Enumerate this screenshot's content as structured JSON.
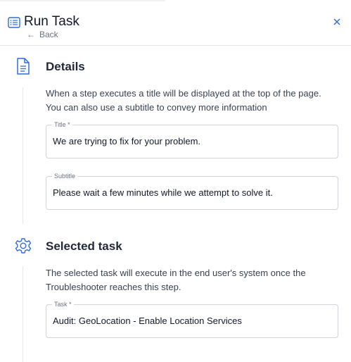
{
  "header": {
    "title": "Run Task",
    "back_label": "Back",
    "icons": {
      "title": "list-icon",
      "back": "arrow-left-icon",
      "close": "close-icon"
    }
  },
  "details": {
    "title": "Details",
    "icon": "document-icon",
    "description_line1": "When a step executes a title will be displayed at the top of the page.",
    "description_line2": "You can also use a subtitle to convey more information",
    "title_field": {
      "label": "Title *",
      "value": "We are trying to fix for your problem."
    },
    "subtitle_field": {
      "label": "Subtitle",
      "value": "Please wait a few minutes while we attempt to solve it."
    }
  },
  "selected_task": {
    "title": "Selected task",
    "icon": "gear-icon",
    "description_line1": "The selected task will execute in the end user's system once the",
    "description_line2": "Troubleshooter reaches this step.",
    "task_field": {
      "label": "Task *",
      "value": "Audit: GeoLocation - Enable Location Services"
    }
  },
  "colors": {
    "accent": "#2f6bd8",
    "border": "#d1d5db",
    "text": "#1f2937",
    "muted": "#6b7280"
  }
}
